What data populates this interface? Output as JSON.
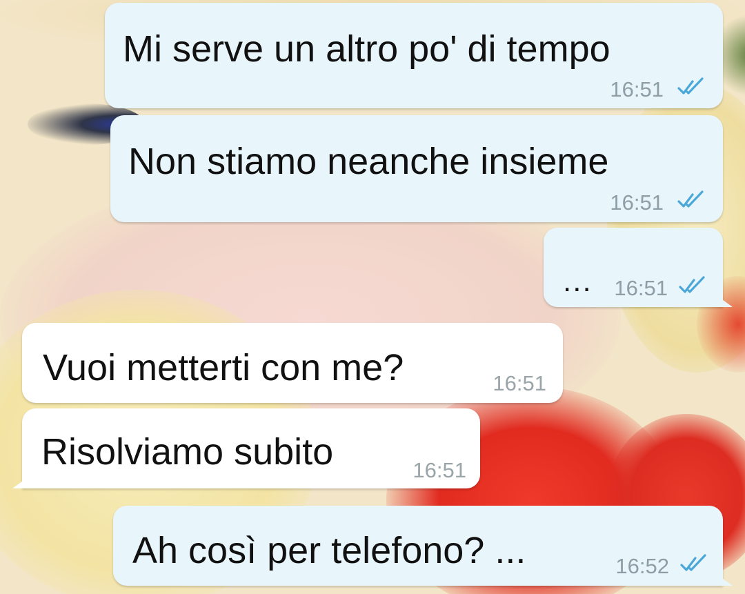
{
  "colors": {
    "outgoing_bubble": "#e8f5fb",
    "incoming_bubble": "#ffffff",
    "read_ticks": "#4aa7d8",
    "timestamp": "#8d9ea6"
  },
  "messages": [
    {
      "direction": "outgoing",
      "text": "Mi serve un altro po' di tempo",
      "time": "16:51",
      "status_icon": "double-check-read"
    },
    {
      "direction": "outgoing",
      "text": "Non stiamo neanche insieme",
      "time": "16:51",
      "status_icon": "double-check-read"
    },
    {
      "direction": "outgoing",
      "text": "...",
      "time": "16:51",
      "status_icon": "double-check-read"
    },
    {
      "direction": "incoming",
      "text": "Vuoi metterti con me?",
      "time": "16:51"
    },
    {
      "direction": "incoming",
      "text": "Risolviamo subito",
      "time": "16:51"
    },
    {
      "direction": "outgoing",
      "text": "Ah così per telefono? ...",
      "time": "16:52",
      "status_icon": "double-check-read"
    }
  ]
}
